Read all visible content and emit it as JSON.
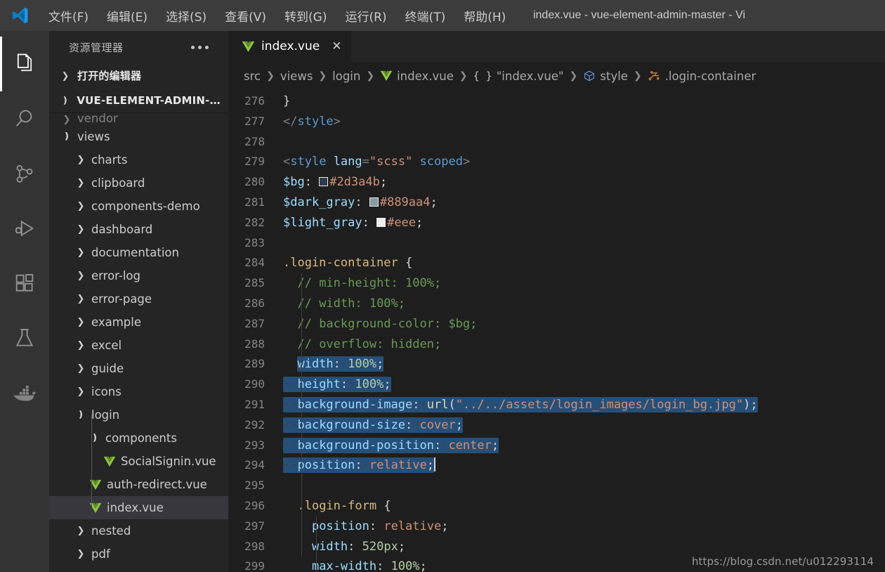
{
  "titlebar": {
    "logo_icon": "vscode-logo",
    "menus": [
      "文件(F)",
      "编辑(E)",
      "选择(S)",
      "查看(V)",
      "转到(G)",
      "运行(R)",
      "终端(T)",
      "帮助(H)"
    ],
    "window_title": "index.vue - vue-element-admin-master - Vi"
  },
  "activitybar": {
    "items": [
      {
        "name": "explorer",
        "icon": "files-icon",
        "active": true
      },
      {
        "name": "search",
        "icon": "search-icon",
        "active": false
      },
      {
        "name": "source-control",
        "icon": "source-control-icon",
        "active": false
      },
      {
        "name": "run-and-debug",
        "icon": "run-debug-icon",
        "active": false
      },
      {
        "name": "extensions",
        "icon": "extensions-icon",
        "active": false
      },
      {
        "name": "testing",
        "icon": "beaker-icon",
        "active": false
      },
      {
        "name": "docker",
        "icon": "docker-whale-icon",
        "active": false
      }
    ]
  },
  "sidebar": {
    "header_title": "资源管理器",
    "more_actions_icon": "ellipsis-icon",
    "open_editors_label": "打开的编辑器",
    "project_label": "VUE-ELEMENT-ADMIN-M...",
    "tree": [
      {
        "label": "vendor",
        "depth": 1,
        "type": "folder",
        "state": "collapsed",
        "clipped": true
      },
      {
        "label": "views",
        "depth": 1,
        "type": "folder",
        "state": "expanded"
      },
      {
        "label": "charts",
        "depth": 2,
        "type": "folder",
        "state": "collapsed"
      },
      {
        "label": "clipboard",
        "depth": 2,
        "type": "folder",
        "state": "collapsed"
      },
      {
        "label": "components-demo",
        "depth": 2,
        "type": "folder",
        "state": "collapsed"
      },
      {
        "label": "dashboard",
        "depth": 2,
        "type": "folder",
        "state": "collapsed"
      },
      {
        "label": "documentation",
        "depth": 2,
        "type": "folder",
        "state": "collapsed"
      },
      {
        "label": "error-log",
        "depth": 2,
        "type": "folder",
        "state": "collapsed"
      },
      {
        "label": "error-page",
        "depth": 2,
        "type": "folder",
        "state": "collapsed"
      },
      {
        "label": "example",
        "depth": 2,
        "type": "folder",
        "state": "collapsed"
      },
      {
        "label": "excel",
        "depth": 2,
        "type": "folder",
        "state": "collapsed"
      },
      {
        "label": "guide",
        "depth": 2,
        "type": "folder",
        "state": "collapsed"
      },
      {
        "label": "icons",
        "depth": 2,
        "type": "folder",
        "state": "collapsed"
      },
      {
        "label": "login",
        "depth": 2,
        "type": "folder",
        "state": "expanded"
      },
      {
        "label": "components",
        "depth": 3,
        "type": "folder",
        "state": "expanded"
      },
      {
        "label": "SocialSignin.vue",
        "depth": 4,
        "type": "vue-file"
      },
      {
        "label": "auth-redirect.vue",
        "depth": 3,
        "type": "vue-file"
      },
      {
        "label": "index.vue",
        "depth": 3,
        "type": "vue-file",
        "selected": true
      },
      {
        "label": "nested",
        "depth": 2,
        "type": "folder",
        "state": "collapsed"
      },
      {
        "label": "pdf",
        "depth": 2,
        "type": "folder",
        "state": "collapsed"
      }
    ]
  },
  "editor": {
    "tab": {
      "label": "index.vue",
      "icon": "vue-file-icon",
      "close_icon": "close-icon",
      "active": true
    },
    "breadcrumb": [
      {
        "label": "src",
        "icon": ""
      },
      {
        "label": "views",
        "icon": ""
      },
      {
        "label": "login",
        "icon": ""
      },
      {
        "label": "index.vue",
        "icon": "vue-file-icon"
      },
      {
        "label": "\"index.vue\"",
        "icon": "braces-icon"
      },
      {
        "label": "style",
        "icon": "symbol-namespace-icon"
      },
      {
        "label": ".login-container",
        "icon": "symbol-ruler-icon"
      }
    ],
    "first_line_number": 276,
    "lines": [
      {
        "n": 276,
        "html": "<span class='t-plain'>}</span>"
      },
      {
        "n": 277,
        "html": "<span class='t-punct'>&lt;/</span><span class='t-tag'>style</span><span class='t-punct'>&gt;</span>"
      },
      {
        "n": 278,
        "html": ""
      },
      {
        "n": 279,
        "html": "<span class='t-punct'>&lt;</span><span class='t-tag'>style</span> <span class='t-attr'>lang</span><span class='t-punct'>=</span><span class='t-str'>\"scss\"</span> <span class='t-tag'>scoped</span><span class='t-punct'>&gt;</span>"
      },
      {
        "n": 280,
        "html": "<span class='t-var'>$bg</span><span class='t-plain'>: </span><span class='swatch' style='background:#2d3a4b'></span><span class='t-val'>#2d3a4b</span><span class='t-plain'>;</span>"
      },
      {
        "n": 281,
        "html": "<span class='t-var'>$dark_gray</span><span class='t-plain'>: </span><span class='swatch' style='background:#889aa4'></span><span class='t-val'>#889aa4</span><span class='t-plain'>;</span>"
      },
      {
        "n": 282,
        "html": "<span class='t-var'>$light_gray</span><span class='t-plain'>: </span><span class='swatch' style='background:#eeeeee'></span><span class='t-val'>#eee</span><span class='t-plain'>;</span>"
      },
      {
        "n": 283,
        "html": ""
      },
      {
        "n": 284,
        "html": "<span class='t-sel'>.login-container</span> <span class='t-plain'>{</span>"
      },
      {
        "n": 285,
        "html": "  <span class='t-comment'>// min-height: 100%;</span>"
      },
      {
        "n": 286,
        "html": "  <span class='t-comment'>// width: 100%;</span>"
      },
      {
        "n": 287,
        "html": "  <span class='t-comment'>// background-color: $bg;</span>"
      },
      {
        "n": 288,
        "html": "  <span class='t-comment'>// overflow: hidden;</span>"
      },
      {
        "n": 289,
        "html": "  <span class='sel-bg'><span class='t-prop'>width</span><span class='t-plain'>:</span><span class='ws'>·</span><span class='t-num'>100%</span><span class='t-plain'>;</span></span>",
        "selected": true
      },
      {
        "n": 290,
        "html": "<span class='sel-bg'><span class='ws'>··</span><span class='t-prop'>height</span><span class='t-plain'>:</span><span class='ws'>·</span><span class='t-num'>100%</span><span class='t-plain'>;</span></span>",
        "selected": true
      },
      {
        "n": 291,
        "html": "<span class='sel-bg'><span class='ws'>··</span><span class='t-prop'>background-image</span><span class='t-plain'>:</span><span class='ws'>·</span><span class='t-fn'>url</span><span class='t-plain'>(</span><span class='t-val'>\"../../assets/login_images/login_bg.jpg\"</span><span class='t-plain'>);</span></span>",
        "selected": true
      },
      {
        "n": 292,
        "html": "<span class='sel-bg'><span class='ws'>··</span><span class='t-prop'>background-size</span><span class='t-plain'>:</span><span class='ws'>·</span><span class='t-val'>cover</span><span class='t-plain'>;</span></span>",
        "selected": true
      },
      {
        "n": 293,
        "html": "<span class='sel-bg'><span class='ws'>··</span><span class='t-prop'>background-position</span><span class='t-plain'>:</span><span class='ws'>·</span><span class='t-val'>center</span><span class='t-plain'>;</span></span>",
        "selected": true
      },
      {
        "n": 294,
        "html": "<span class='sel-bg'><span class='ws'>··</span><span class='t-prop'>position</span><span class='t-plain'>:</span><span class='ws'>·</span><span class='t-val'>relative</span><span class='t-plain'>;</span></span><span class='caret-bar'></span>",
        "selected": true
      },
      {
        "n": 295,
        "html": ""
      },
      {
        "n": 296,
        "html": "  <span class='t-sel'>.login-form</span> <span class='t-plain'>{</span>"
      },
      {
        "n": 297,
        "html": "    <span class='t-prop'>position</span><span class='t-plain'>: </span><span class='t-val'>relative</span><span class='t-plain'>;</span>"
      },
      {
        "n": 298,
        "html": "    <span class='t-prop'>width</span><span class='t-plain'>: </span><span class='t-num'>520px</span><span class='t-plain'>;</span>"
      },
      {
        "n": 299,
        "html": "    <span class='t-prop'>max-width</span><span class='t-plain'>: </span><span class='t-num'>100%</span><span class='t-plain'>;</span>"
      }
    ]
  },
  "watermark": {
    "text": "https://blog.csdn.net/u012293114"
  },
  "colors": {
    "titlebar_bg": "#3c3c3c",
    "activitybar_bg": "#333333",
    "sidebar_bg": "#252526",
    "editor_bg": "#1e1e1e",
    "selection_bg": "#264f78",
    "tree_selected_bg": "#37373d",
    "vue_green": "#80c040",
    "accent_blue": "#0098ff"
  }
}
